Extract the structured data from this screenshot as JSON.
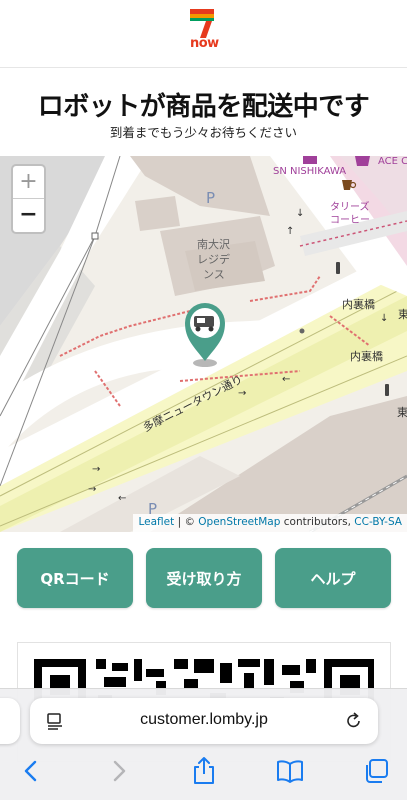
{
  "header": {
    "logo_text": "now",
    "logo_number": "7"
  },
  "title": "ロボットが商品を配送中です",
  "subtitle": "到着までもう少々お待ちください",
  "map": {
    "zoom_in_label": "+",
    "zoom_out_label": "−",
    "labels": {
      "building": "南大沢\nレジデンス",
      "building_line1": "南大沢",
      "building_line2": "レジデ",
      "building_line3": "ンス",
      "parking_top": "P",
      "parking_bottom": "P",
      "store": "SN NISHIKAWA",
      "ace": "ACE C",
      "cafe_line1": "タリーズ",
      "cafe_line2": "コーヒー",
      "bridge1": "内裏橋",
      "bridge2": "内裏橋",
      "road": "多摩ニュータウン通り",
      "side1": "東",
      "side2": "東"
    },
    "attribution": {
      "leaflet": "Leaflet",
      "sep": " | © ",
      "osm": "OpenStreetMap",
      "contrib": " contributors, ",
      "license": "CC-BY-SA"
    },
    "accent_color": "#4a9e8a"
  },
  "buttons": {
    "qr": "QRコード",
    "howto": "受け取り方",
    "help": "ヘルプ"
  },
  "browser": {
    "url": "customer.lomby.jp"
  },
  "icons": {
    "back": "chevron-left-icon",
    "forward": "chevron-right-icon",
    "share": "share-icon",
    "bookmarks": "book-icon",
    "tabs": "tabs-icon",
    "reload": "reload-icon",
    "reader": "reader-icon"
  }
}
